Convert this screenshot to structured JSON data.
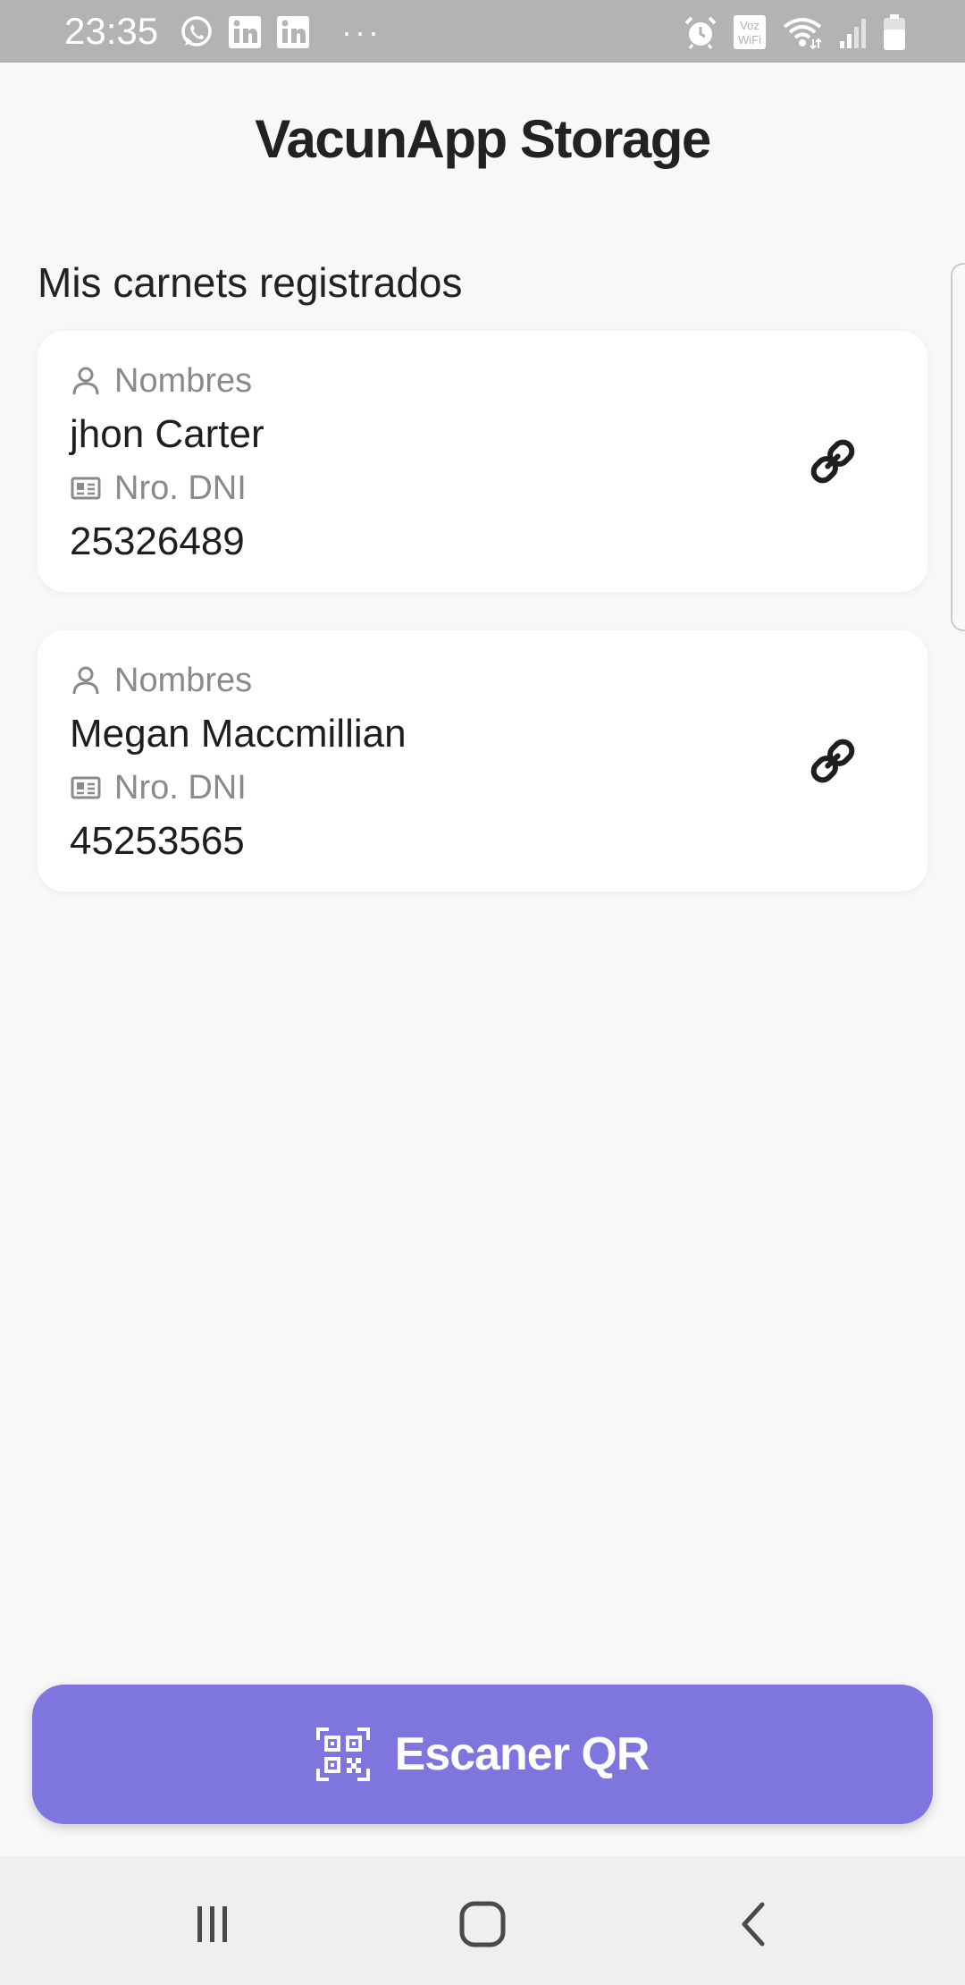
{
  "status_bar": {
    "time": "23:35",
    "more": "···",
    "left_icons": [
      "whatsapp-icon",
      "linkedin-icon",
      "linkedin-icon"
    ],
    "right_icons": [
      "alarm-icon",
      "vowifi-icon",
      "wifi-icon",
      "signal-icon",
      "battery-icon"
    ],
    "vowifi_text": [
      "Voz",
      "WiFi"
    ]
  },
  "header": {
    "title": "VacunApp Storage"
  },
  "section": {
    "title": "Mis carnets registrados"
  },
  "cards": [
    {
      "name_label": "Nombres",
      "name": "jhon Carter",
      "dni_label": "Nro. DNI",
      "dni": "25326489"
    },
    {
      "name_label": "Nombres",
      "name": "Megan Maccmillian",
      "dni_label": "Nro. DNI",
      "dni": "45253565"
    }
  ],
  "scan_button": {
    "label": "Escaner QR",
    "icon": "qr-scan-icon"
  },
  "nav": {
    "items": [
      "recents-icon",
      "home-icon",
      "back-icon"
    ]
  },
  "colors": {
    "status_bar": "#b3b3b3",
    "background": "#f8f8f8",
    "card": "#ffffff",
    "accent": "#7e75de",
    "nav_bar": "#efefef"
  }
}
